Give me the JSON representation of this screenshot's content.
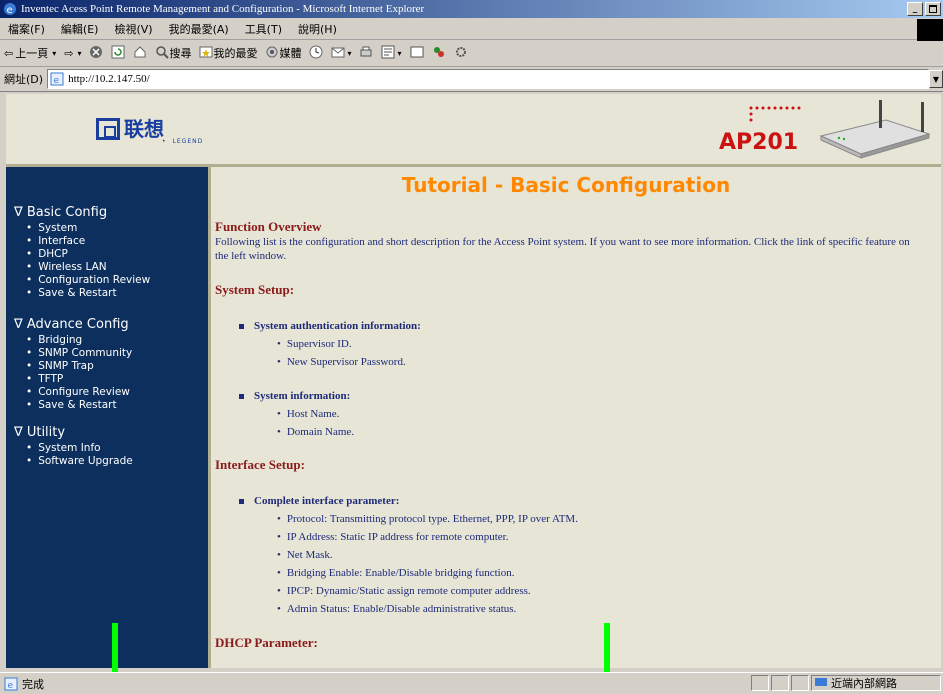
{
  "window": {
    "title": "Inventec Acess Point Remote Management and Configuration - Microsoft Internet Explorer",
    "controls": [
      "_",
      "⬜",
      "×"
    ]
  },
  "menu": [
    "檔案(F)",
    "編輯(E)",
    "檢視(V)",
    "我的最愛(A)",
    "工具(T)",
    "說明(H)"
  ],
  "toolbar": {
    "back": "上一頁",
    "search": "搜尋",
    "favorites": "我的最愛",
    "media": "媒體"
  },
  "address": {
    "label": "網址(D)",
    "url": "http://10.2.147.50/"
  },
  "banner": {
    "logo_text": "联想",
    "logo_sub": "LEGEND",
    "product": "AP201"
  },
  "sidebar": {
    "sections": [
      {
        "title": "∇ Basic Config",
        "items": [
          "System",
          "Interface",
          "DHCP",
          "Wireless LAN",
          "Configuration Review",
          "Save & Restart"
        ]
      },
      {
        "title": "∇ Advance Config",
        "items": [
          "Bridging",
          "SNMP Community",
          "SNMP Trap",
          "TFTP",
          "Configure Review",
          "Save & Restart"
        ]
      },
      {
        "title": "∇ Utility",
        "items": [
          "System Info",
          "Software Upgrade"
        ]
      }
    ]
  },
  "content": {
    "title": "Tutorial - Basic Configuration",
    "overview_head": "Function Overview",
    "overview_text": "Following list is the configuration and short description for the  Access Point system. If you want to see more information. Click the link of specific feature on the left window.",
    "system_setup": "System Setup:",
    "sys_auth": "System authentication information:",
    "sys_auth_items": [
      "Supervisor ID.",
      "New Supervisor Password."
    ],
    "sys_info": "System information:",
    "sys_info_items": [
      "Host Name.",
      "Domain Name."
    ],
    "interface_setup": "Interface Setup:",
    "iface_param": "Complete interface parameter:",
    "iface_items": [
      "Protocol: Transmitting protocol type. Ethernet, PPP, IP over ATM.",
      "IP Address: Static IP address for remote computer.",
      "Net Mask.",
      "Bridging Enable: Enable/Disable bridging function.",
      "IPCP: Dynamic/Static assign remote computer address.",
      "Admin Status: Enable/Disable administrative status."
    ],
    "dhcp_param": "DHCP Parameter:"
  },
  "status": {
    "done": "完成",
    "zone": "近端內部網路"
  },
  "colors": {
    "sidebar_bg": "#0c2f5e",
    "title_orange": "#ff8800",
    "heading_red": "#8b1a1a",
    "text_blue": "#1f2a7a",
    "page_bg": "#e6e5d6"
  }
}
